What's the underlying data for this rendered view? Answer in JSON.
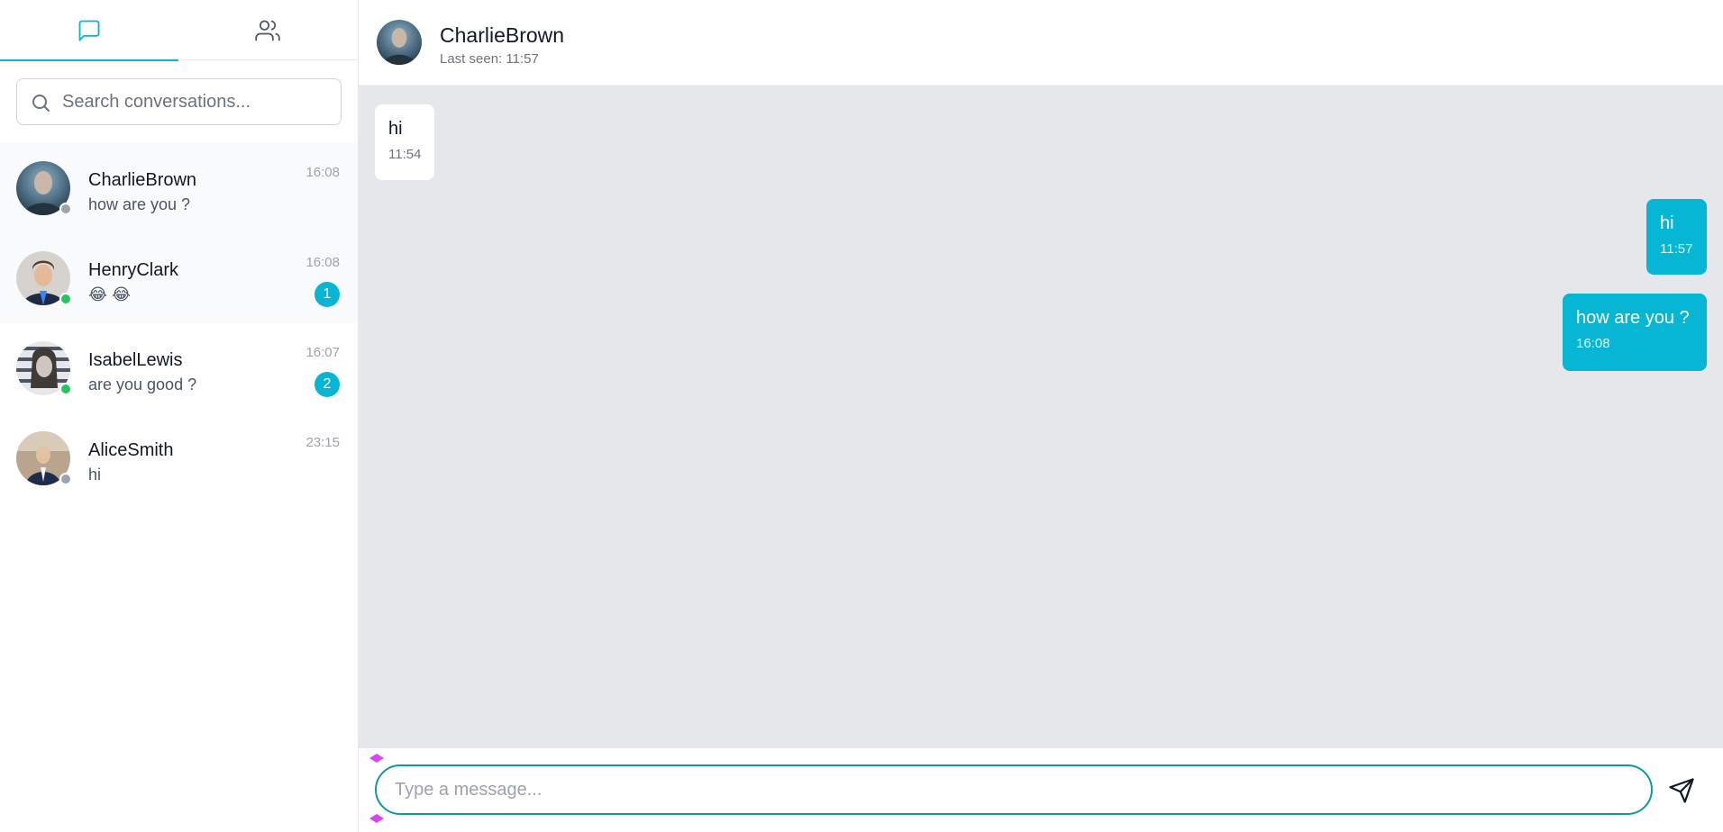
{
  "sidebar": {
    "tabs": [
      {
        "name": "chat-bubble-icon",
        "active": true
      },
      {
        "name": "users-icon",
        "active": false
      }
    ],
    "search": {
      "placeholder": "Search conversations..."
    },
    "conversations": [
      {
        "name": "CharlieBrown",
        "preview": "how are you ?",
        "time": "16:08",
        "badge": "",
        "status": "offline"
      },
      {
        "name": "HenryClark",
        "preview": "😂 😂",
        "time": "16:08",
        "badge": "1",
        "status": "online"
      },
      {
        "name": "IsabelLewis",
        "preview": "are you good ?",
        "time": "16:07",
        "badge": "2",
        "status": "online"
      },
      {
        "name": "AliceSmith",
        "preview": "hi",
        "time": "23:15",
        "badge": "",
        "status": "offline"
      }
    ]
  },
  "chat": {
    "contact": "CharlieBrown",
    "last_seen": "Last seen: 11:57",
    "messages": [
      {
        "direction": "in",
        "text": "hi",
        "time": "11:54"
      },
      {
        "direction": "out",
        "text": "hi",
        "time": "11:57"
      },
      {
        "direction": "out",
        "text": "how are you ?",
        "time": "16:08"
      }
    ],
    "composer": {
      "placeholder": "Type a message..."
    }
  },
  "colors": {
    "accent": "#06b6d4",
    "online": "#22c55e",
    "offline": "#9ca3af",
    "chat_bg": "#e5e7eb",
    "input_border": "#0e98a8"
  }
}
